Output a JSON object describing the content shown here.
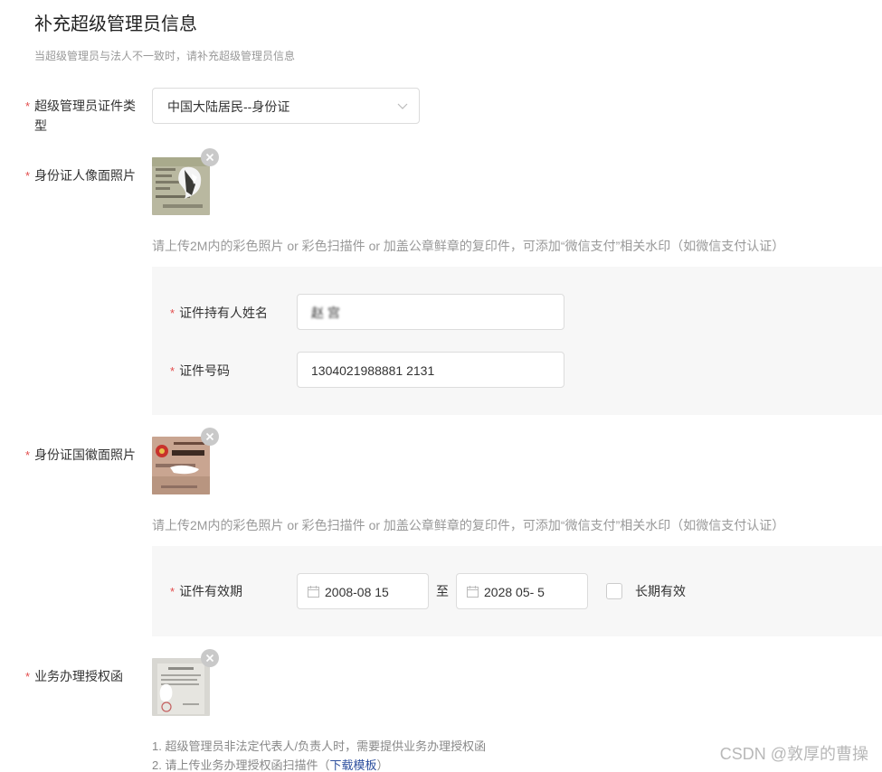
{
  "header": {
    "title": "补充超级管理员信息",
    "subtitle": "当超级管理员与法人不一致时，请补充超级管理员信息"
  },
  "form": {
    "required_mark": "*",
    "id_type": {
      "label_line1": "超级管理员证件类",
      "label_line2": "型",
      "value": "中国大陆居民--身份证"
    },
    "portrait_photo": {
      "label": "身份证人像面照片",
      "hint": "请上传2M内的彩色照片 or 彩色扫描件 or 加盖公章鲜章的复印件，可添加“微信支付”相关水印（如微信支付认证）"
    },
    "holder_name": {
      "label": "证件持有人姓名",
      "value": "赵 宫"
    },
    "id_number": {
      "label": "证件号码",
      "value": "1304021988881 2131"
    },
    "emblem_photo": {
      "label": "身份证国徽面照片",
      "hint": "请上传2M内的彩色照片 or 彩色扫描件 or 加盖公章鲜章的复印件，可添加“微信支付”相关水印（如微信支付认证）"
    },
    "validity": {
      "label": "证件有效期",
      "start": "2008-08 15",
      "separator": "至",
      "end": "2028 05- 5",
      "long_term_label": "长期有效",
      "long_term_checked": false
    },
    "authorization": {
      "label": "业务办理授权函",
      "note1": "1. 超级管理员非法定代表人/负责人时，需要提供业务办理授权函",
      "note2_prefix": "2. 请上传业务办理授权函扫描件（",
      "note2_link": "下载模板",
      "note2_suffix": "）"
    }
  },
  "watermark": "CSDN @敦厚的曹操"
}
